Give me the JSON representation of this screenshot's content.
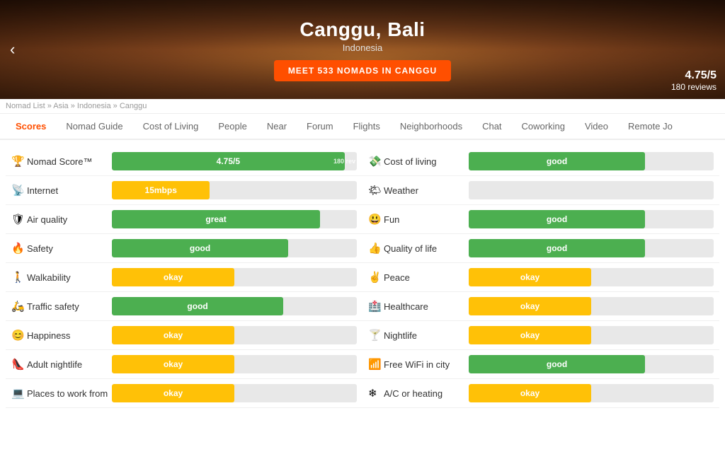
{
  "hero": {
    "title": "Canggu, Bali",
    "subtitle": "Indonesia",
    "cta": "MEET 533 NOMADS IN CANGGU",
    "rating": "4.75/5",
    "reviews": "180 reviews"
  },
  "breadcrumb": {
    "text": "Nomad List » Asia » Indonesia » Canggu"
  },
  "nav": {
    "tabs": [
      {
        "label": "Scores",
        "active": true
      },
      {
        "label": "Nomad Guide",
        "active": false
      },
      {
        "label": "Cost of Living",
        "active": false
      },
      {
        "label": "People",
        "active": false
      },
      {
        "label": "Near",
        "active": false
      },
      {
        "label": "Forum",
        "active": false
      },
      {
        "label": "Flights",
        "active": false
      },
      {
        "label": "Neighborhoods",
        "active": false
      },
      {
        "label": "Chat",
        "active": false
      },
      {
        "label": "Coworking",
        "active": false
      },
      {
        "label": "Video",
        "active": false
      },
      {
        "label": "Remote Jo",
        "active": false
      }
    ]
  },
  "scores": {
    "left": [
      {
        "icon": "🏆",
        "label": "Nomad Score™",
        "value": "4.75/5",
        "badge": "180 rev",
        "color": "green",
        "pct": 95
      },
      {
        "icon": "📡",
        "label": "Internet",
        "value": "15mbps",
        "color": "yellow",
        "pct": 40
      },
      {
        "icon": "🛡",
        "label": "Air quality",
        "value": "great",
        "color": "green",
        "pct": 85
      },
      {
        "icon": "🔥",
        "label": "Safety",
        "value": "good",
        "color": "green",
        "pct": 72
      },
      {
        "icon": "🚶",
        "label": "Walkability",
        "value": "okay",
        "color": "yellow",
        "pct": 50
      },
      {
        "icon": "🛵",
        "label": "Traffic safety",
        "value": "good",
        "color": "green",
        "pct": 70
      },
      {
        "icon": "😊",
        "label": "Happiness",
        "value": "okay",
        "color": "yellow",
        "pct": 50
      },
      {
        "icon": "👠",
        "label": "Adult nightlife",
        "value": "okay",
        "color": "yellow",
        "pct": 50
      },
      {
        "icon": "💻",
        "label": "Places to work from",
        "value": "okay",
        "color": "yellow",
        "pct": 50
      }
    ],
    "right": [
      {
        "icon": "💸",
        "label": "Cost of living",
        "value": "good",
        "color": "green",
        "pct": 72
      },
      {
        "icon": "🌤",
        "label": "Weather",
        "value": "",
        "color": "gray",
        "pct": 0
      },
      {
        "icon": "😃",
        "label": "Fun",
        "value": "good",
        "color": "green",
        "pct": 72
      },
      {
        "icon": "👍",
        "label": "Quality of life",
        "value": "good",
        "color": "green",
        "pct": 72
      },
      {
        "icon": "✌",
        "label": "Peace",
        "value": "okay",
        "color": "yellow",
        "pct": 50
      },
      {
        "icon": "🏥",
        "label": "Healthcare",
        "value": "okay",
        "color": "yellow",
        "pct": 50
      },
      {
        "icon": "🍸",
        "label": "Nightlife",
        "value": "okay",
        "color": "yellow",
        "pct": 50
      },
      {
        "icon": "📶",
        "label": "Free WiFi in city",
        "value": "good",
        "color": "green",
        "pct": 72
      },
      {
        "icon": "❄",
        "label": "A/C or heating",
        "value": "okay",
        "color": "yellow",
        "pct": 50
      }
    ]
  }
}
